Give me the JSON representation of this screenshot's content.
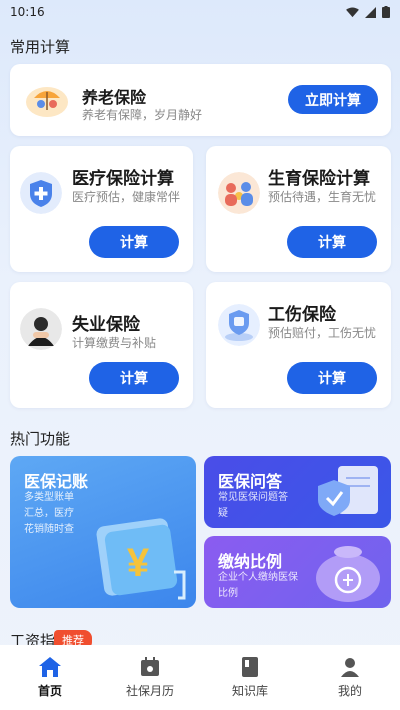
{
  "status_bar": {
    "time": "10:16"
  },
  "sections": {
    "common_calc": "常用计算",
    "hot_features": "热门功能",
    "wage_guide": "工资指"
  },
  "pension": {
    "title": "养老保险",
    "subtitle": "养老有保障，岁月静好",
    "button": "立即计算",
    "icon": "umbrella-couple-icon"
  },
  "insurance_cards": [
    {
      "title": "医疗保险计算",
      "subtitle": "医疗预估，健康常伴",
      "button": "计算",
      "icon": "medical-shield-icon"
    },
    {
      "title": "生育保险计算",
      "subtitle": "预估待遇，生育无忧",
      "button": "计算",
      "icon": "family-icon"
    },
    {
      "title": "失业保险",
      "subtitle": "计算缴费与补贴",
      "button": "计算",
      "icon": "stressed-person-icon"
    },
    {
      "title": "工伤保险",
      "subtitle": "预估赔付，工伤无忧",
      "button": "计算",
      "icon": "injury-shield-icon"
    }
  ],
  "features": {
    "ledger": {
      "title": "医保记账",
      "subtitle": "多类型账单汇总，医疗花销随时查",
      "icon": "yuan-card-icon"
    },
    "qa": {
      "title": "医保问答",
      "subtitle": "常见医保问题答疑",
      "icon": "shield-document-icon"
    },
    "ratio": {
      "title": "缴纳比例",
      "subtitle": "企业个人缴纳医保比例",
      "icon": "money-bag-icon"
    }
  },
  "badge": "推荐",
  "tabs": [
    {
      "label": "首页",
      "icon": "home-icon",
      "active": true
    },
    {
      "label": "社保月历",
      "icon": "calendar-icon",
      "active": false
    },
    {
      "label": "知识库",
      "icon": "book-icon",
      "active": false
    },
    {
      "label": "我的",
      "icon": "person-icon",
      "active": false
    }
  ],
  "colors": {
    "primary": "#1f63e6",
    "badge": "#f04e2f"
  }
}
